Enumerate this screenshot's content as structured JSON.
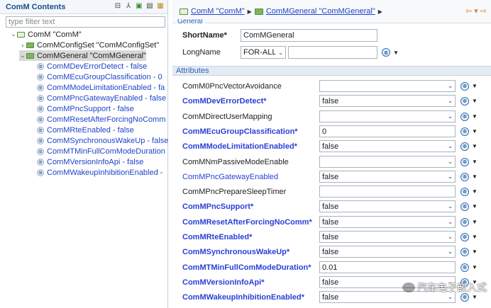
{
  "left": {
    "title": "ComM Contents",
    "filter_placeholder": "type filter text",
    "tree": {
      "root": "ComM \"ComM\"",
      "config_set": "ComMConfigSet \"ComMConfigSet\"",
      "general": "ComMGeneral \"ComMGeneral\"",
      "leaves": [
        "ComMDevErrorDetect - false",
        "ComMEcuGroupClassification - 0",
        "ComMModeLimitationEnabled - fa",
        "ComMPncGatewayEnabled - false",
        "ComMPncSupport - false",
        "ComMResetAfterForcingNoComm",
        "ComMRteEnabled - false",
        "ComMSynchronousWakeUp - false",
        "ComMTMinFullComModeDuration",
        "ComMVersionInfoApi - false",
        "ComMWakeupInhibitionEnabled - "
      ]
    }
  },
  "right": {
    "breadcrumb": [
      "ComM \"ComM\"",
      "ComMGeneral \"ComMGeneral\""
    ],
    "section_general": "General",
    "shortname_label": "ShortName*",
    "shortname_value": "ComMGeneral",
    "longname_label": "LongName",
    "longname_lang": "FOR-ALL",
    "longname_value": "",
    "attributes_label": "Attributes",
    "attributes": [
      {
        "name": "ComM0PncVectorAvoidance",
        "value": "",
        "style": "normal",
        "kind": "select"
      },
      {
        "name": "ComMDevErrorDetect*",
        "value": "false",
        "style": "bold",
        "kind": "select"
      },
      {
        "name": "ComMDirectUserMapping",
        "value": "",
        "style": "normal",
        "kind": "select"
      },
      {
        "name": "ComMEcuGroupClassification*",
        "value": "0",
        "style": "bold",
        "kind": "text"
      },
      {
        "name": "ComMModeLimitationEnabled*",
        "value": "false",
        "style": "bold",
        "kind": "select"
      },
      {
        "name": "ComMNmPassiveModeEnable",
        "value": "",
        "style": "normal",
        "kind": "select"
      },
      {
        "name": "ComMPncGatewayEnabled",
        "value": "false",
        "style": "blue",
        "kind": "select"
      },
      {
        "name": "ComMPncPrepareSleepTimer",
        "value": "",
        "style": "normal",
        "kind": "text"
      },
      {
        "name": "ComMPncSupport*",
        "value": "false",
        "style": "bold",
        "kind": "select"
      },
      {
        "name": "ComMResetAfterForcingNoComm*",
        "value": "false",
        "style": "bold",
        "kind": "select"
      },
      {
        "name": "ComMRteEnabled*",
        "value": "false",
        "style": "bold",
        "kind": "select"
      },
      {
        "name": "ComMSynchronousWakeUp*",
        "value": "false",
        "style": "bold",
        "kind": "select"
      },
      {
        "name": "ComMTMinFullComModeDuration*",
        "value": "0.01",
        "style": "bold",
        "kind": "text"
      },
      {
        "name": "ComMVersionInfoApi*",
        "value": "false",
        "style": "bold",
        "kind": "select"
      },
      {
        "name": "ComMWakeupInhibitionEnabled*",
        "value": "false",
        "style": "bold",
        "kind": "select"
      }
    ]
  },
  "watermark": "汽车电子嵌入式"
}
